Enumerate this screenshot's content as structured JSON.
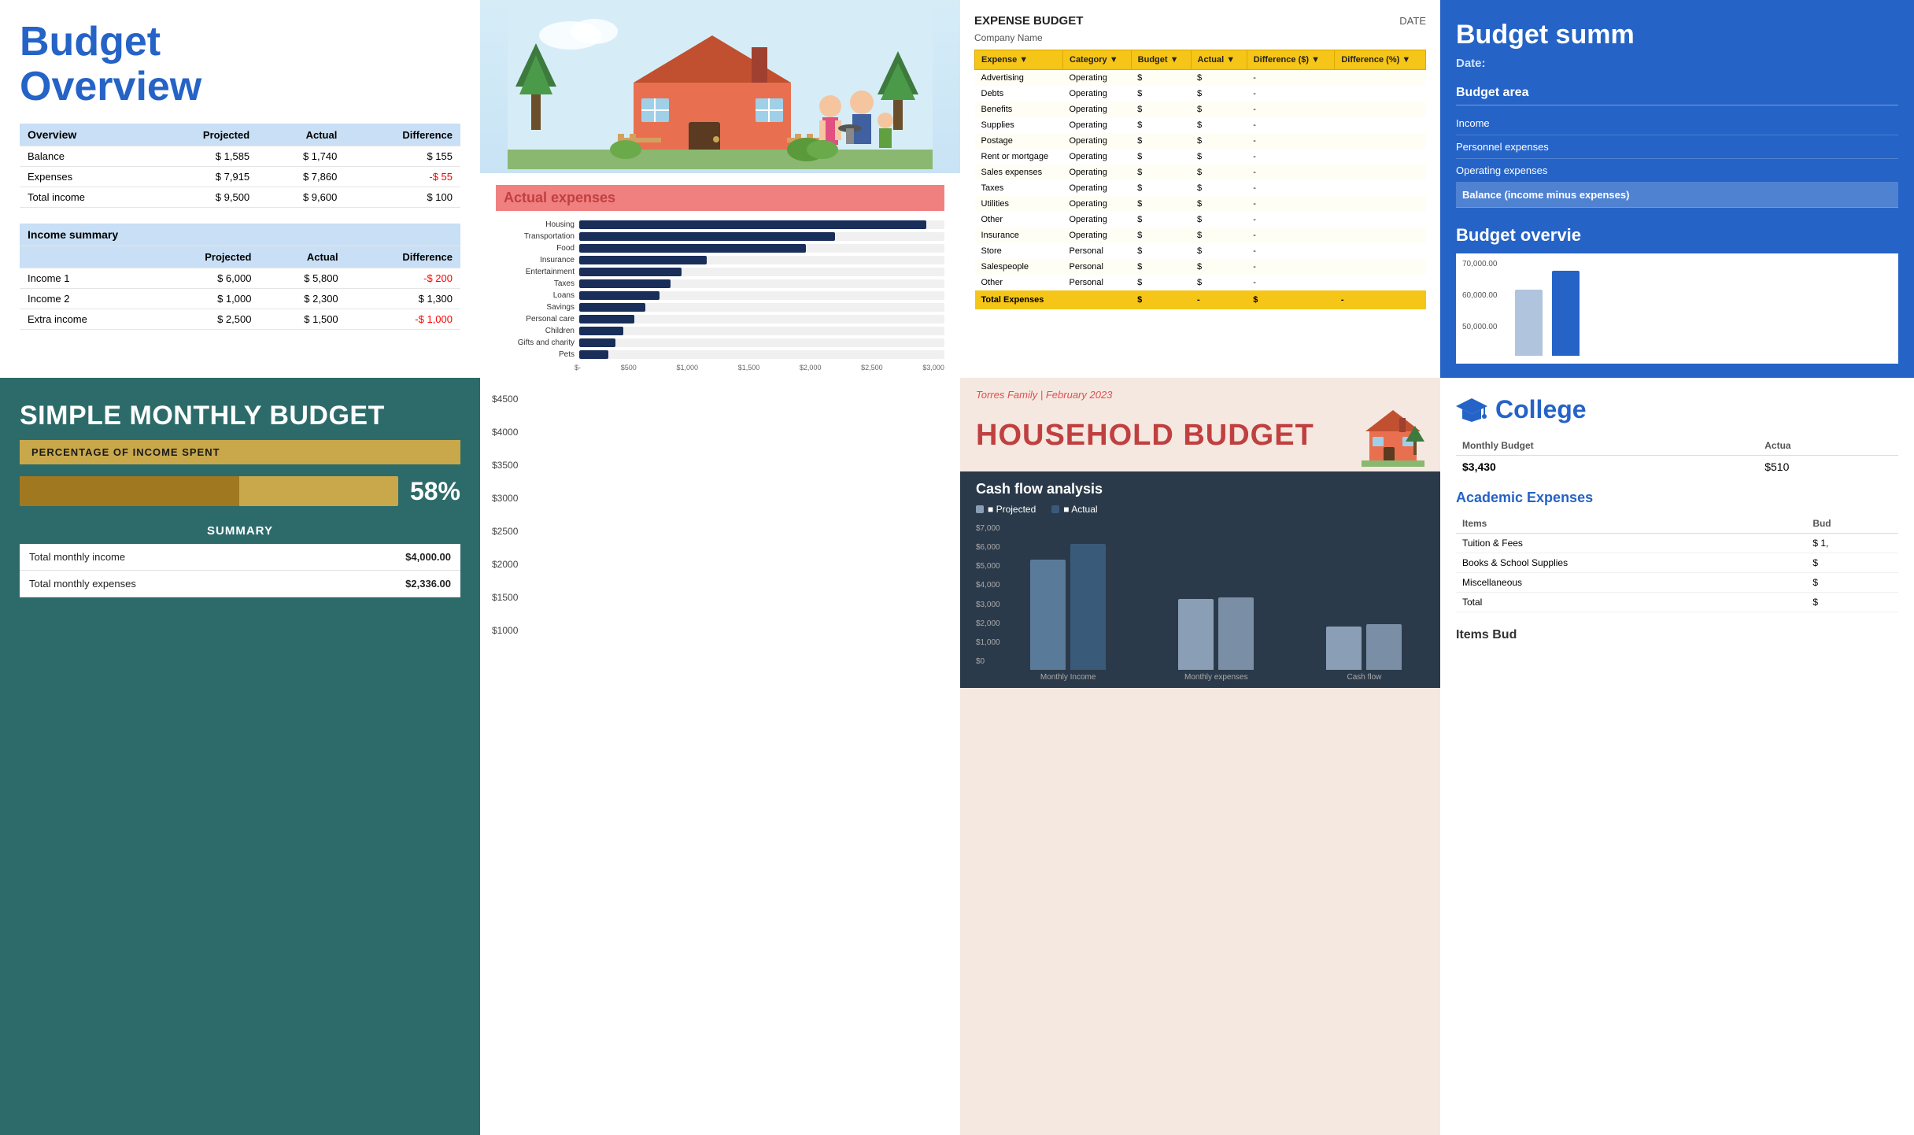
{
  "card1": {
    "title": "Budget\nOverview",
    "overview_label": "Overview",
    "col_projected": "Projected",
    "col_actual": "Actual",
    "col_diff": "Difference",
    "rows": [
      {
        "label": "Balance",
        "projected": "$ 1,585",
        "actual": "$ 1,740",
        "diff": "$ 155",
        "neg": false
      },
      {
        "label": "Expenses",
        "projected": "$ 7,915",
        "actual": "$ 7,860",
        "diff": "-$ 55",
        "neg": true
      },
      {
        "label": "Total income",
        "projected": "$ 9,500",
        "actual": "$ 9,600",
        "diff": "$ 100",
        "neg": false
      }
    ],
    "income_summary_label": "Income summary",
    "income_rows": [
      {
        "label": "Income 1",
        "projected": "$ 6,000",
        "actual": "$ 5,800",
        "diff": "-$ 200",
        "neg": true
      },
      {
        "label": "Income 2",
        "projected": "$ 1,000",
        "actual": "$ 2,300",
        "diff": "$ 1,300",
        "neg": false
      },
      {
        "label": "Extra income",
        "projected": "$ 2,500",
        "actual": "$ 1,500",
        "diff": "-$ 1,000",
        "neg": true
      }
    ]
  },
  "card2": {
    "chart_title": "Actual expenses",
    "bars": [
      {
        "label": "Housing",
        "pct": 95
      },
      {
        "label": "Transportation",
        "pct": 70
      },
      {
        "label": "Food",
        "pct": 62
      },
      {
        "label": "Insurance",
        "pct": 35
      },
      {
        "label": "Entertainment",
        "pct": 28
      },
      {
        "label": "Taxes",
        "pct": 25
      },
      {
        "label": "Loans",
        "pct": 22
      },
      {
        "label": "Savings",
        "pct": 18
      },
      {
        "label": "Personal care",
        "pct": 15
      },
      {
        "label": "Children",
        "pct": 12
      },
      {
        "label": "Gifts and charity",
        "pct": 10
      },
      {
        "label": "Pets",
        "pct": 8
      }
    ],
    "x_labels": [
      "$-",
      "$500",
      "$1,000",
      "$1,500",
      "$2,000",
      "$2,500",
      "$3,000"
    ]
  },
  "card3": {
    "title": "EXPENSE BUDGET",
    "date_label": "DATE",
    "company_label": "Company Name",
    "columns": [
      "Expense",
      "Category",
      "Budget",
      "Actual",
      "Difference ($)",
      "Difference (%)"
    ],
    "rows": [
      {
        "expense": "Advertising",
        "category": "Operating",
        "budget": "$",
        "actual": "$",
        "diff_s": "-",
        "diff_p": ""
      },
      {
        "expense": "Debts",
        "category": "Operating",
        "budget": "$",
        "actual": "$",
        "diff_s": "-",
        "diff_p": ""
      },
      {
        "expense": "Benefits",
        "category": "Operating",
        "budget": "$",
        "actual": "$",
        "diff_s": "-",
        "diff_p": ""
      },
      {
        "expense": "Supplies",
        "category": "Operating",
        "budget": "$",
        "actual": "$",
        "diff_s": "-",
        "diff_p": ""
      },
      {
        "expense": "Postage",
        "category": "Operating",
        "budget": "$",
        "actual": "$",
        "diff_s": "-",
        "diff_p": ""
      },
      {
        "expense": "Rent or mortgage",
        "category": "Operating",
        "budget": "$",
        "actual": "$",
        "diff_s": "-",
        "diff_p": ""
      },
      {
        "expense": "Sales expenses",
        "category": "Operating",
        "budget": "$",
        "actual": "$",
        "diff_s": "-",
        "diff_p": ""
      },
      {
        "expense": "Taxes",
        "category": "Operating",
        "budget": "$",
        "actual": "$",
        "diff_s": "-",
        "diff_p": ""
      },
      {
        "expense": "Utilities",
        "category": "Operating",
        "budget": "$",
        "actual": "$",
        "diff_s": "-",
        "diff_p": ""
      },
      {
        "expense": "Other",
        "category": "Operating",
        "budget": "$",
        "actual": "$",
        "diff_s": "-",
        "diff_p": ""
      },
      {
        "expense": "Insurance",
        "category": "Operating",
        "budget": "$",
        "actual": "$",
        "diff_s": "-",
        "diff_p": ""
      },
      {
        "expense": "Store",
        "category": "Personal",
        "budget": "$",
        "actual": "$",
        "diff_s": "-",
        "diff_p": ""
      },
      {
        "expense": "Salespeople",
        "category": "Personal",
        "budget": "$",
        "actual": "$",
        "diff_s": "-",
        "diff_p": ""
      },
      {
        "expense": "Other",
        "category": "Personal",
        "budget": "$",
        "actual": "$",
        "diff_s": "-",
        "diff_p": ""
      }
    ],
    "total_label": "Total Expenses",
    "total_vals": [
      "$",
      "-",
      "$",
      "-",
      "$",
      "-"
    ]
  },
  "card4": {
    "title": "Budget summ",
    "date_label": "Date:",
    "budget_area_title": "Budget area",
    "budget_items": [
      "Income",
      "Personnel expenses",
      "Operating expenses",
      "Balance (income minus expenses)"
    ],
    "budget_overview_title": "Budget overvie",
    "chart_y_labels": [
      "70,000.00",
      "60,000.00",
      "50,000.00"
    ],
    "chart_bars": [
      {
        "color": "#b0c4de",
        "height": 70
      },
      {
        "color": "#2563c7",
        "height": 90
      }
    ]
  },
  "card5": {
    "title": "SIMPLE MONTHLY BUDGET",
    "pct_label": "PERCENTAGE OF INCOME SPENT",
    "pct_value": "58%",
    "pct_fill": 58,
    "summary_header": "SUMMARY",
    "summary_rows": [
      {
        "label": "Total monthly income",
        "value": "$4,000.00"
      },
      {
        "label": "Total monthly expenses",
        "value": "$2,336.00"
      }
    ],
    "yaxis_values": [
      "$4500",
      "$4000",
      "$3500",
      "$3000",
      "$2500",
      "$2000",
      "$1500",
      "$1000"
    ]
  },
  "card6": {
    "family_date": "Torres Family | February 2023",
    "title": "HOUSEHOLD BUDGET",
    "cf_title": "Cash flow analysis",
    "legend": [
      "Projected",
      "Actual"
    ],
    "yaxis": [
      "$7,000",
      "$6,000",
      "$5,000",
      "$4,000",
      "$3,000",
      "$2,000",
      "$1,000",
      "$0"
    ],
    "groups": [
      {
        "label": "Monthly Income",
        "proj_height": 140,
        "act_height": 160,
        "proj_color": "#5a7a9a",
        "act_color": "#3a5a7a"
      },
      {
        "label": "Monthly expenses",
        "proj_height": 90,
        "act_height": 92,
        "proj_color": "#8a9fb5",
        "act_color": "#7a8fa5"
      },
      {
        "label": "Cash flow",
        "proj_height": 55,
        "act_height": 58,
        "proj_color": "#8a9fb5",
        "act_color": "#7a8fa5"
      }
    ]
  },
  "card7": {
    "college_label": "College",
    "monthly_budget_col": "Monthly Budget",
    "actual_col": "Actua",
    "monthly_budget_val": "$3,430",
    "actual_val": "$510",
    "academic_title": "Academic Expenses",
    "items_col": "Items",
    "bud_col": "Bud",
    "academic_rows": [
      {
        "item": "Tuition & Fees",
        "bud": "$ 1,"
      },
      {
        "item": "Books & School Supplies",
        "bud": "$"
      },
      {
        "item": "Miscellaneous",
        "bud": "$"
      },
      {
        "item": "Total",
        "bud": "$"
      }
    ],
    "items_bud_label": "Items Bud"
  }
}
